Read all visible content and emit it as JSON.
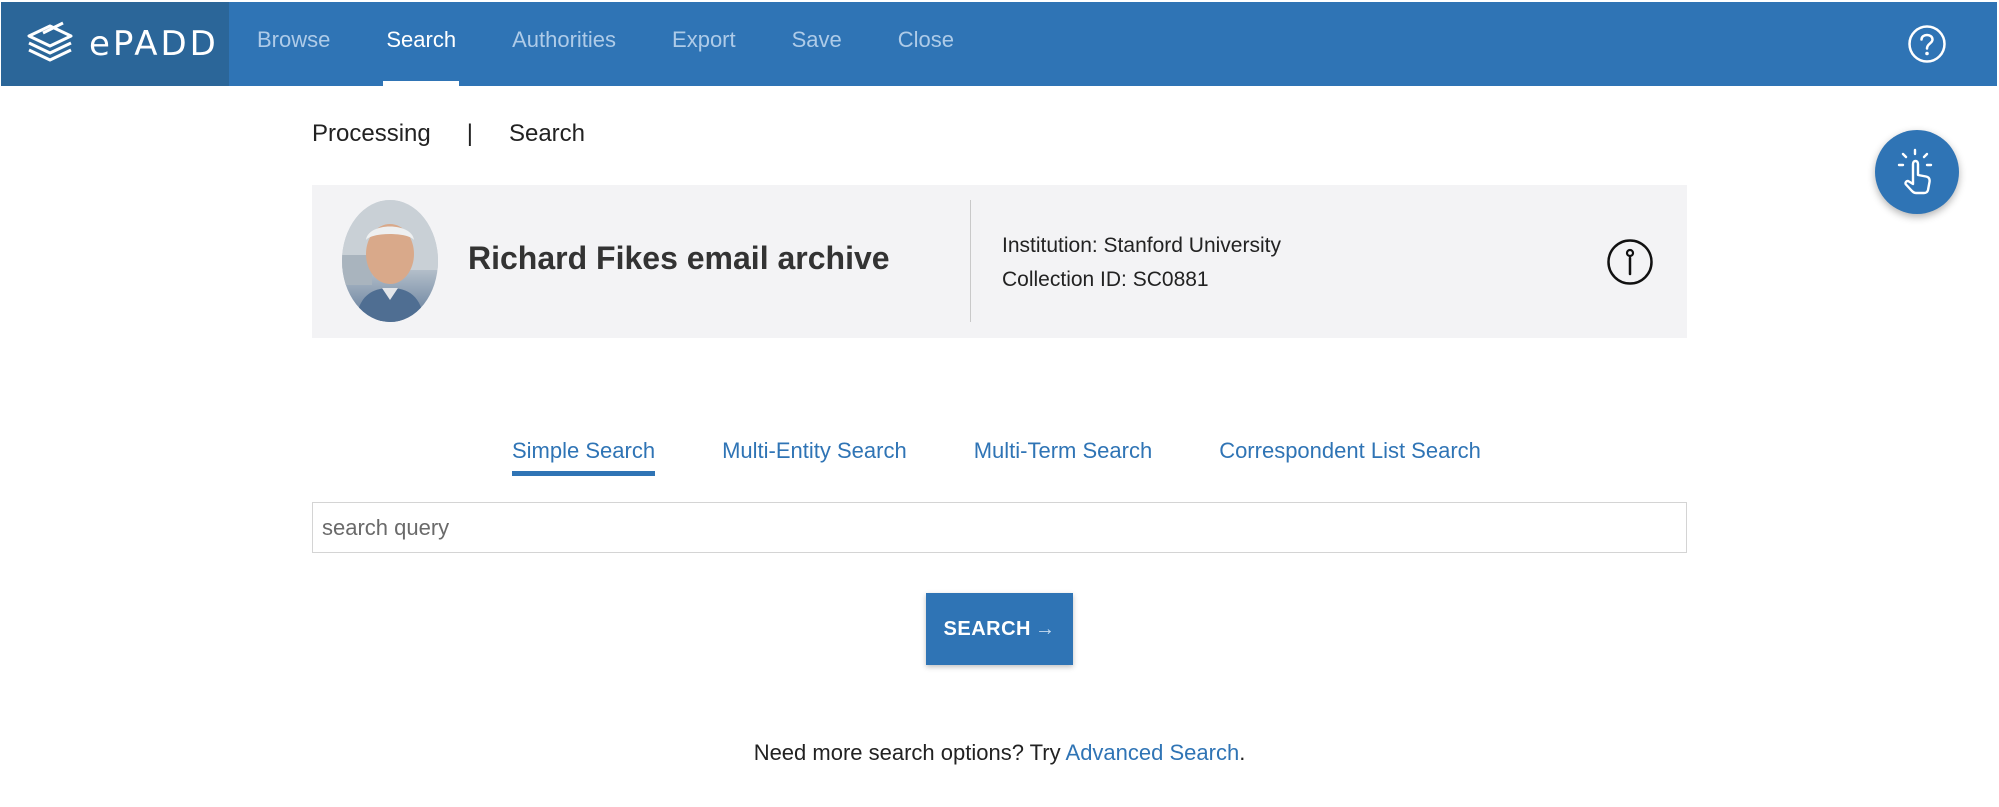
{
  "app": {
    "logo_text": "ePADD"
  },
  "nav": {
    "items": [
      {
        "label": "Browse",
        "active": false
      },
      {
        "label": "Search",
        "active": true
      },
      {
        "label": "Authorities",
        "active": false
      },
      {
        "label": "Export",
        "active": false
      },
      {
        "label": "Save",
        "active": false
      },
      {
        "label": "Close",
        "active": false
      }
    ],
    "help_icon": "question-circle-icon"
  },
  "breadcrumb": {
    "section": "Processing",
    "separator": "|",
    "page": "Search"
  },
  "archive": {
    "title": "Richard Fikes email archive",
    "institution": "Institution: Stanford University",
    "collection_id": "Collection ID: SC0881",
    "info_icon": "info-circle-icon"
  },
  "search": {
    "tabs": [
      {
        "label": "Simple Search",
        "active": true
      },
      {
        "label": "Multi-Entity Search",
        "active": false
      },
      {
        "label": "Multi-Term Search",
        "active": false
      },
      {
        "label": "Correspondent List Search",
        "active": false
      }
    ],
    "placeholder": "search query",
    "button_label": "SEARCH",
    "button_arrow": "→"
  },
  "more_options": {
    "prefix": "Need more search options? Try ",
    "link": "Advanced Search",
    "suffix": "."
  },
  "colors": {
    "brand": "#2f74b5",
    "logo_bg": "#2b6699",
    "card_bg": "#f3f3f5"
  }
}
